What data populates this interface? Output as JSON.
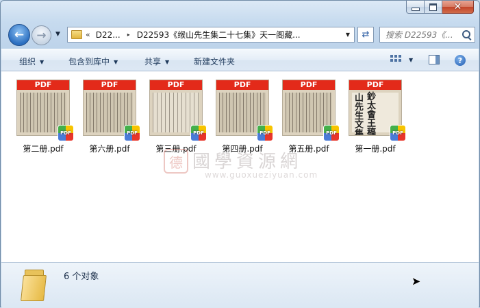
{
  "window": {
    "caption": {
      "minimize": "minimize",
      "maximize": "maximize",
      "close": "✕"
    }
  },
  "nav": {
    "back_glyph": "←",
    "forward_glyph": "→",
    "history_glyph": "▼"
  },
  "address": {
    "chevron": "«",
    "segments": [
      "D22...",
      "D22593《缑山先生集二十七集》天一阁藏..."
    ],
    "separator": "▸",
    "drop_glyph": "▼"
  },
  "refresh_glyph": "⇄",
  "search": {
    "placeholder": "搜索 D22593《..."
  },
  "toolbar": {
    "organize": "组织",
    "include_library": "包含到库中",
    "share": "共享",
    "new_folder": "新建文件夹",
    "arrow": "▼",
    "help": "?"
  },
  "files": [
    {
      "name": "第二册.pdf",
      "badge": "PDF",
      "style": "dense"
    },
    {
      "name": "第六册.pdf",
      "badge": "PDF",
      "style": "dense"
    },
    {
      "name": "第三册.pdf",
      "badge": "PDF",
      "style": "light"
    },
    {
      "name": "第四册.pdf",
      "badge": "PDF",
      "style": "dense"
    },
    {
      "name": "第五册.pdf",
      "badge": "PDF",
      "style": "dense"
    },
    {
      "name": "第一册.pdf",
      "badge": "PDF",
      "style": "title",
      "cover_chars": [
        "山",
        "先",
        "生",
        "文",
        "集",
        "鈔",
        "太",
        "會",
        "王",
        "稿"
      ]
    }
  ],
  "thumb_bar_label": "PDF",
  "watermark": {
    "seal": "德",
    "title": "國學資源網",
    "url": "www.guoxueziyuan.com"
  },
  "details": {
    "count": "6 个对象"
  },
  "colors": {
    "pdf_red": "#e32a1a",
    "link_blue": "#1e395b"
  }
}
